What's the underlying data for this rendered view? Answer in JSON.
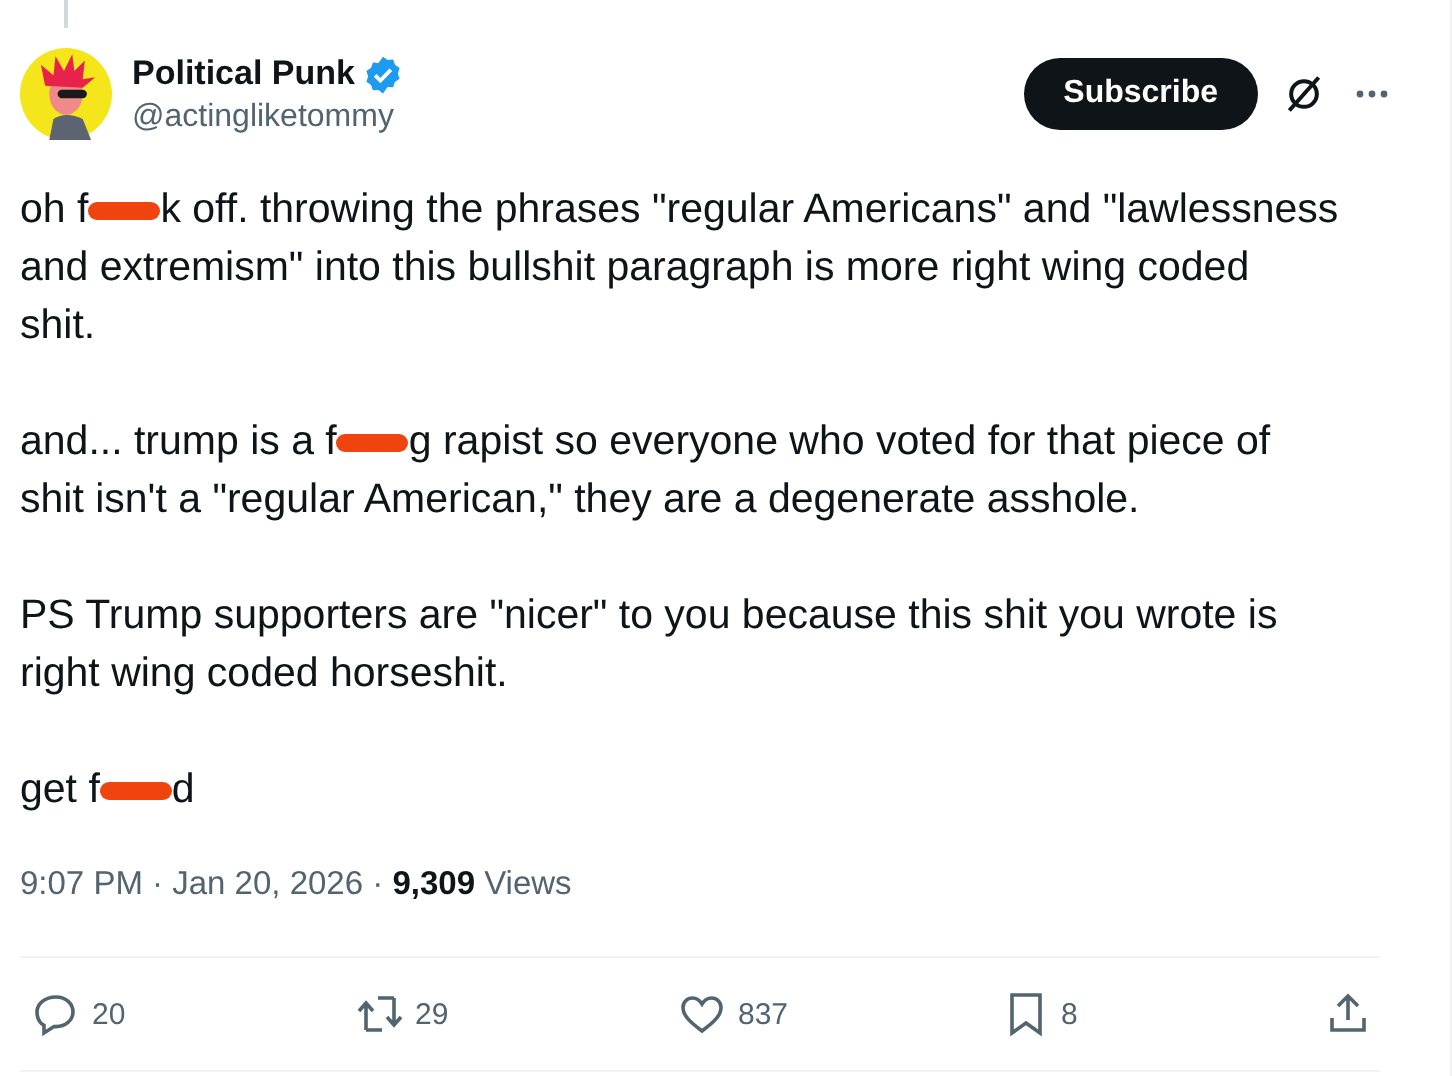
{
  "author": {
    "name": "Political Punk",
    "verified": true,
    "handle": "@actingliketommy"
  },
  "subscribe_button": "Subscribe",
  "paragraphs": [
    {
      "lines": [
        [
          {
            "kind": "text",
            "text": "oh f"
          },
          {
            "kind": "redaction"
          },
          {
            "kind": "text",
            "text": "k off. throwing the phrases \"regular Americans\" and \"lawlessness"
          }
        ],
        [
          {
            "kind": "text",
            "text": "and extremism\" into this bullshit paragraph is more right wing coded"
          }
        ],
        [
          {
            "kind": "text",
            "text": "shit."
          }
        ]
      ]
    },
    {
      "lines": [
        [
          {
            "kind": "text",
            "text": "and... trump is a f"
          },
          {
            "kind": "redaction"
          },
          {
            "kind": "text",
            "text": "g rapist so everyone who voted for that piece of"
          }
        ],
        [
          {
            "kind": "text",
            "text": "shit isn't a \"regular American,\" they are a degenerate asshole."
          }
        ]
      ]
    },
    {
      "lines": [
        [
          {
            "kind": "text",
            "text": "PS Trump supporters are \"nicer\" to you because this shit you wrote is"
          }
        ],
        [
          {
            "kind": "text",
            "text": "right wing coded horseshit."
          }
        ]
      ]
    },
    {
      "lines": [
        [
          {
            "kind": "text",
            "text": "get f"
          },
          {
            "kind": "redaction"
          },
          {
            "kind": "text",
            "text": "d"
          }
        ]
      ]
    }
  ],
  "meta": "9:07 PM · Jan 20, 2026 · **9,309** Views",
  "actions": [
    {
      "kind": "reply",
      "count": "20"
    },
    {
      "kind": "repost",
      "count": "29"
    },
    {
      "kind": "like",
      "count": "837"
    },
    {
      "kind": "bookmark",
      "count": "8"
    },
    {
      "kind": "share"
    }
  ]
}
